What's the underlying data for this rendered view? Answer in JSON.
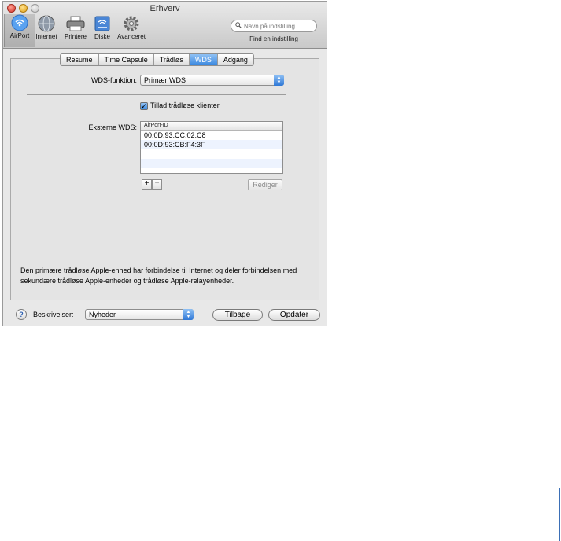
{
  "window": {
    "title": "Erhverv"
  },
  "toolbar": {
    "items": [
      {
        "label": "AirPort",
        "icon": "airport-icon",
        "selected": true
      },
      {
        "label": "Internet",
        "icon": "globe-icon"
      },
      {
        "label": "Printere",
        "icon": "printer-icon"
      },
      {
        "label": "Diske",
        "icon": "disk-icon"
      },
      {
        "label": "Avanceret",
        "icon": "gear-icon"
      }
    ],
    "search_placeholder": "Navn på indstilling",
    "search_caption": "Find en indstilling"
  },
  "tabs": [
    {
      "label": "Resume"
    },
    {
      "label": "Time Capsule"
    },
    {
      "label": "Trådløs"
    },
    {
      "label": "WDS",
      "active": true
    },
    {
      "label": "Adgang"
    }
  ],
  "wds": {
    "mode_label": "WDS-funktion:",
    "mode_value": "Primær WDS",
    "allow_clients_label": "Tillad trådløse klienter",
    "allow_clients_checked": true,
    "remote_label": "Eksterne WDS:",
    "column_header": "AirPort-ID",
    "remote_ids": [
      "00:0D:93:CC:02:C8",
      "00:0D:93:CB:F4:3F"
    ],
    "add_label": "+",
    "remove_label": "−",
    "edit_label": "Rediger",
    "description": "Den primære trådløse Apple-enhed har forbindelse til Internet og deler forbindelsen med sekundære trådløse Apple-enheder og trådløse Apple-relayenheder."
  },
  "footer": {
    "help_label": "?",
    "profiles_label": "Beskrivelser:",
    "profiles_value": "Nyheder",
    "back_label": "Tilbage",
    "update_label": "Opdater"
  },
  "colors": {
    "accent": "#3a88df",
    "window_bg": "#e8e8e8"
  }
}
